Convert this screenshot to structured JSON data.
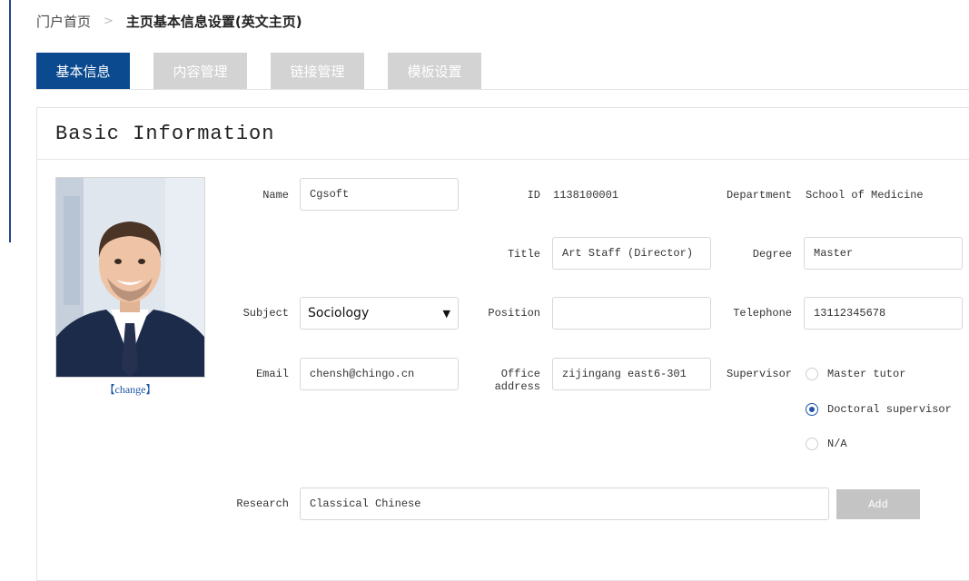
{
  "breadcrumb": {
    "home": "门户首页",
    "separator": ">",
    "current": "主页基本信息设置(英文主页)"
  },
  "tabs": [
    {
      "label": "基本信息",
      "active": true
    },
    {
      "label": "内容管理",
      "active": false
    },
    {
      "label": "链接管理",
      "active": false
    },
    {
      "label": "模板设置",
      "active": false
    }
  ],
  "panel": {
    "title": "Basic Information"
  },
  "photo": {
    "change_label": "【change】"
  },
  "form": {
    "name": {
      "label": "Name",
      "value": "Cgsoft"
    },
    "id": {
      "label": "ID",
      "value": "1138100001"
    },
    "department": {
      "label": "Department",
      "value": "School of Medicine"
    },
    "title": {
      "label": "Title",
      "value": "Art Staff (Director)"
    },
    "degree": {
      "label": "Degree",
      "value": "Master"
    },
    "subject": {
      "label": "Subject",
      "value": "Sociology"
    },
    "position": {
      "label": "Position",
      "value": ""
    },
    "telephone": {
      "label": "Telephone",
      "value": "13112345678"
    },
    "email": {
      "label": "Email",
      "value": "chensh@chingo.cn"
    },
    "office_address": {
      "label_line1": "Office",
      "label_line2": "address",
      "value": "zijingang east6-301"
    },
    "supervisor": {
      "label": "Supervisor",
      "options": [
        {
          "label": "Master tutor",
          "checked": false
        },
        {
          "label": "Doctoral supervisor",
          "checked": true
        },
        {
          "label": "N/A",
          "checked": false
        }
      ]
    },
    "research": {
      "label": "Research",
      "value": "Classical Chinese"
    },
    "add_label": "Add"
  },
  "colors": {
    "accent": "#0b4a8f",
    "tab_inactive": "#d3d3d3",
    "link": "#1f56a6",
    "add_button": "#c4c4c4"
  }
}
